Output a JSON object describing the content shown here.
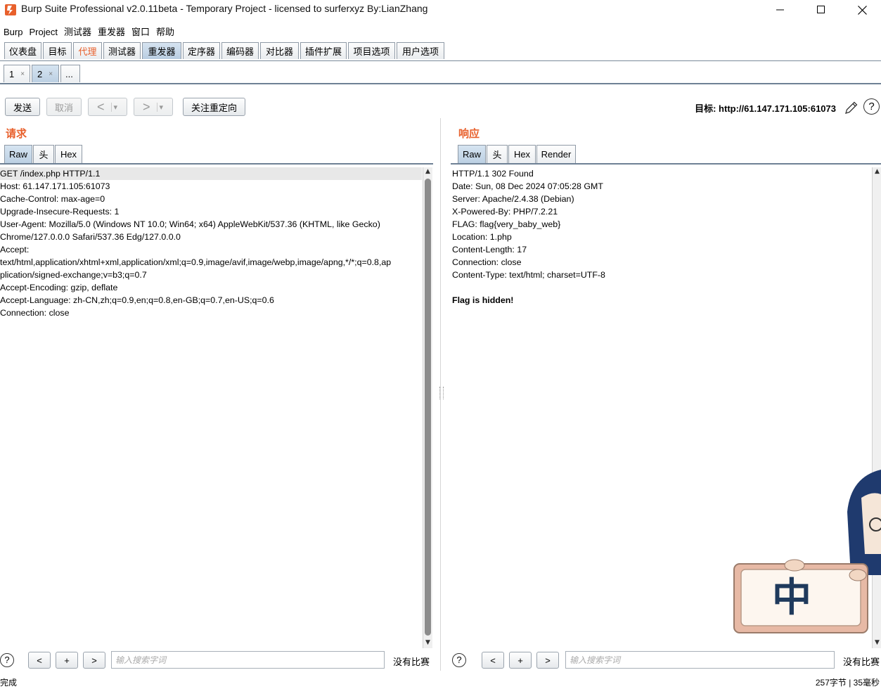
{
  "window": {
    "title": "Burp Suite Professional v2.0.11beta - Temporary Project - licensed to surferxyz By:LianZhang",
    "minimize": "—",
    "maximize": "☐",
    "close": "✕"
  },
  "menu": [
    "Burp",
    "Project",
    "测试器",
    "重发器",
    "窗口",
    "帮助"
  ],
  "main_tabs": [
    "仪表盘",
    "目标",
    "代理",
    "测试器",
    "重发器",
    "定序器",
    "编码器",
    "对比器",
    "插件扩展",
    "项目选项",
    "用户选项"
  ],
  "sub_tabs": [
    {
      "label": "1",
      "close": "×"
    },
    {
      "label": "2",
      "close": "×"
    },
    {
      "label": "..."
    }
  ],
  "toolbar": {
    "send": "发送",
    "cancel": "取消",
    "back": "<",
    "forward": ">",
    "dropdown": "▾",
    "follow_redirect": "关注重定向",
    "target": "目标: http://61.147.171.105:61073",
    "help": "?"
  },
  "request": {
    "title": "请求",
    "tabs": [
      "Raw",
      "头",
      "Hex"
    ],
    "lines": [
      "GET /index.php HTTP/1.1",
      "Host: 61.147.171.105:61073",
      "Cache-Control: max-age=0",
      "Upgrade-Insecure-Requests: 1",
      "User-Agent: Mozilla/5.0 (Windows NT 10.0; Win64; x64) AppleWebKit/537.36 (KHTML, like Gecko)",
      "Chrome/127.0.0.0 Safari/537.36 Edg/127.0.0.0",
      "Accept:",
      "text/html,application/xhtml+xml,application/xml;q=0.9,image/avif,image/webp,image/apng,*/*;q=0.8,ap",
      "plication/signed-exchange;v=b3;q=0.7",
      "Accept-Encoding: gzip, deflate",
      "Accept-Language: zh-CN,zh;q=0.9,en;q=0.8,en-GB;q=0.7,en-US;q=0.6",
      "Connection: close"
    ]
  },
  "response": {
    "title": "响应",
    "tabs": [
      "Raw",
      "头",
      "Hex",
      "Render"
    ],
    "lines": [
      "HTTP/1.1 302 Found",
      "Date: Sun, 08 Dec 2024 07:05:28 GMT",
      "Server: Apache/2.4.38 (Debian)",
      "X-Powered-By: PHP/7.2.21",
      "FLAG: flag{very_baby_web}",
      "Location: 1.php",
      "Content-Length: 17",
      "Connection: close",
      "Content-Type: text/html; charset=UTF-8",
      "",
      "Flag is hidden!"
    ]
  },
  "search": {
    "placeholder": "输入搜索字词",
    "prev": "<",
    "add": "+",
    "next": ">",
    "no_match": "没有比赛",
    "help": "?"
  },
  "status": {
    "left": "完成",
    "right": "257字节 | 35毫秒"
  },
  "ime_badge": "中",
  "colors": {
    "accent": "#e8602c",
    "tab_active": "#bcd0e3",
    "badge_text": "#1f3a5c"
  }
}
